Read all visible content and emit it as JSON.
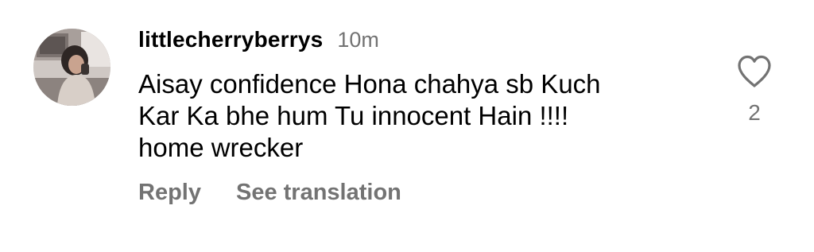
{
  "comment": {
    "username": "littlecherryberrys",
    "timestamp": "10m",
    "text_lines": [
      "Aisay confidence Hona chahya sb Kuch",
      "Kar Ka bhe hum Tu innocent Hain !!!!",
      "home wrecker"
    ],
    "actions": {
      "reply_label": "Reply",
      "translate_label": "See translation"
    },
    "likes": {
      "icon": "heart-outline-icon",
      "count": "2"
    },
    "avatar": {
      "icon": "profile-photo"
    }
  },
  "colors": {
    "text_primary": "#000000",
    "text_secondary": "#737373",
    "background": "#ffffff"
  }
}
